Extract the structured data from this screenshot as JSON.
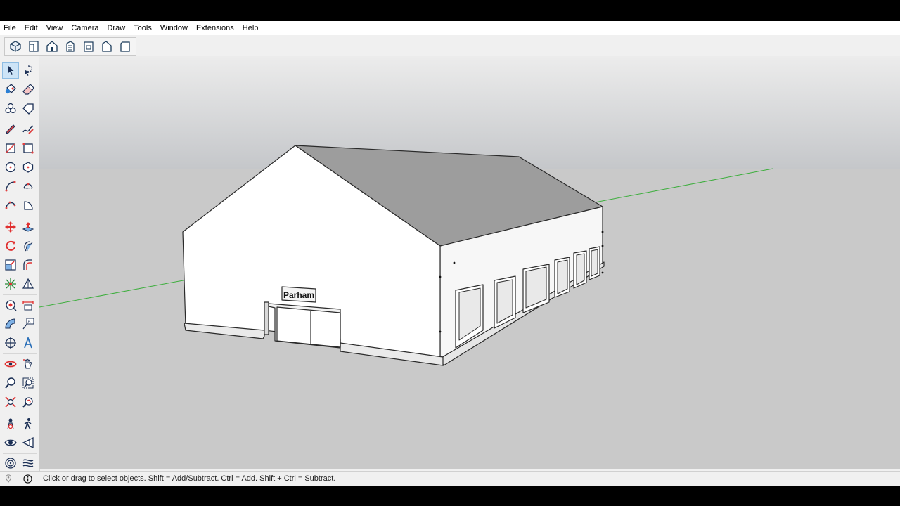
{
  "menu": {
    "file": "File",
    "edit": "Edit",
    "view": "View",
    "camera": "Camera",
    "draw": "Draw",
    "tools": "Tools",
    "window": "Window",
    "extensions": "Extensions",
    "help": "Help"
  },
  "toolbar": {
    "views": [
      "iso-view-icon",
      "top-view-icon",
      "front-view-icon",
      "right-view-icon",
      "back-view-icon",
      "left-view-icon",
      "bottom-view-icon"
    ]
  },
  "tools": [
    "select-icon",
    "lasso-icon",
    "paint-bucket-icon",
    "eraser-icon",
    "component-icon",
    "tag-icon",
    "pencil-icon",
    "freehand-icon",
    "rectangle-icon",
    "rotated-rectangle-icon",
    "circle-icon",
    "polygon-icon",
    "arc-icon",
    "two-point-arc-icon",
    "three-point-arc-icon",
    "pie-icon",
    "move-icon",
    "push-pull-icon",
    "rotate-icon",
    "follow-me-icon",
    "scale-icon",
    "offset-icon",
    "solid-tools-icon",
    "section-plane-icon",
    "tape-measure-icon",
    "dimension-icon",
    "protractor-icon",
    "text-icon",
    "axes-icon",
    "3d-text-icon",
    "orbit-icon",
    "pan-icon",
    "zoom-icon",
    "zoom-window-icon",
    "zoom-extents-icon",
    "previous-view-icon",
    "position-camera-icon",
    "walk-icon",
    "look-around-icon",
    "section-view-icon",
    "sandbox-icon",
    "smoove-icon"
  ],
  "model": {
    "sign_text": "Parham"
  },
  "colors": {
    "sky": "#c7c9cc",
    "ground": "#c9c9c9",
    "roof": "#9d9d9d",
    "wall": "#ffffff",
    "green_axis": "#3cae3c",
    "active_tool": "#cde4f7"
  },
  "status": {
    "message": "Click or drag to select objects. Shift = Add/Subtract. Ctrl = Add. Shift + Ctrl = Subtract."
  }
}
